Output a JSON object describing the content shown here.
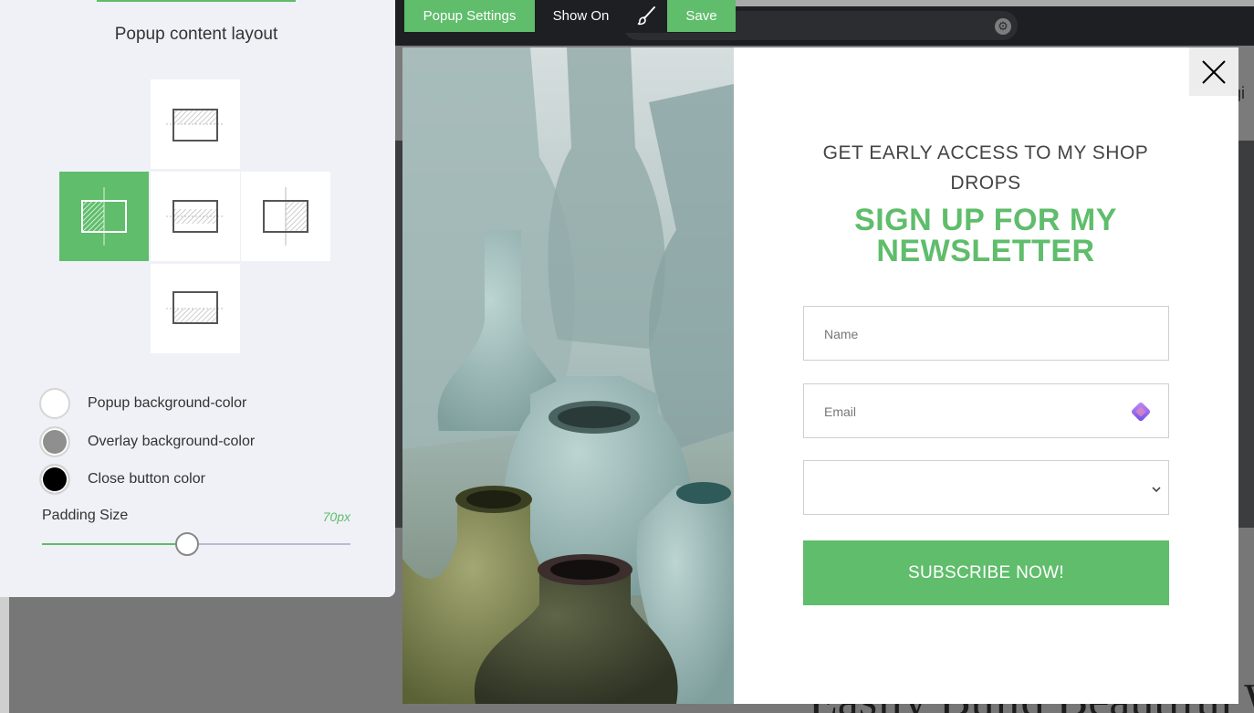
{
  "site": {
    "url_fragment": "page",
    "nav_text": "gi",
    "hero_text": "Easily Build Beautiful W"
  },
  "panel": {
    "section_title": "Popup content layout",
    "layout_options": [
      "top",
      "left",
      "center",
      "right",
      "bottom"
    ],
    "selected_layout": "left",
    "colors": [
      {
        "label": "Popup background-color",
        "color": "#ffffff"
      },
      {
        "label": "Overlay background-color",
        "color": "#8f8f8f"
      },
      {
        "label": "Close button color",
        "color": "#000000"
      }
    ],
    "padding_label": "Padding Size",
    "padding_value": "70px",
    "padding_fraction": 0.47
  },
  "toolbar": {
    "popup_settings_label": "Popup Settings",
    "show_on_label": "Show On",
    "brush_icon": "brush-icon",
    "save_label": "Save"
  },
  "popup": {
    "pre_title": "GET EARLY ACCESS TO MY SHOP DROPS",
    "title": "SIGN UP FOR MY NEWSLETTER",
    "name_placeholder": "Name",
    "email_placeholder": "Email",
    "select_value": "",
    "subscribe_label": "SUBSCRIBE NOW!",
    "close_icon": "close-icon",
    "accent_color": "#5fbd6b"
  }
}
